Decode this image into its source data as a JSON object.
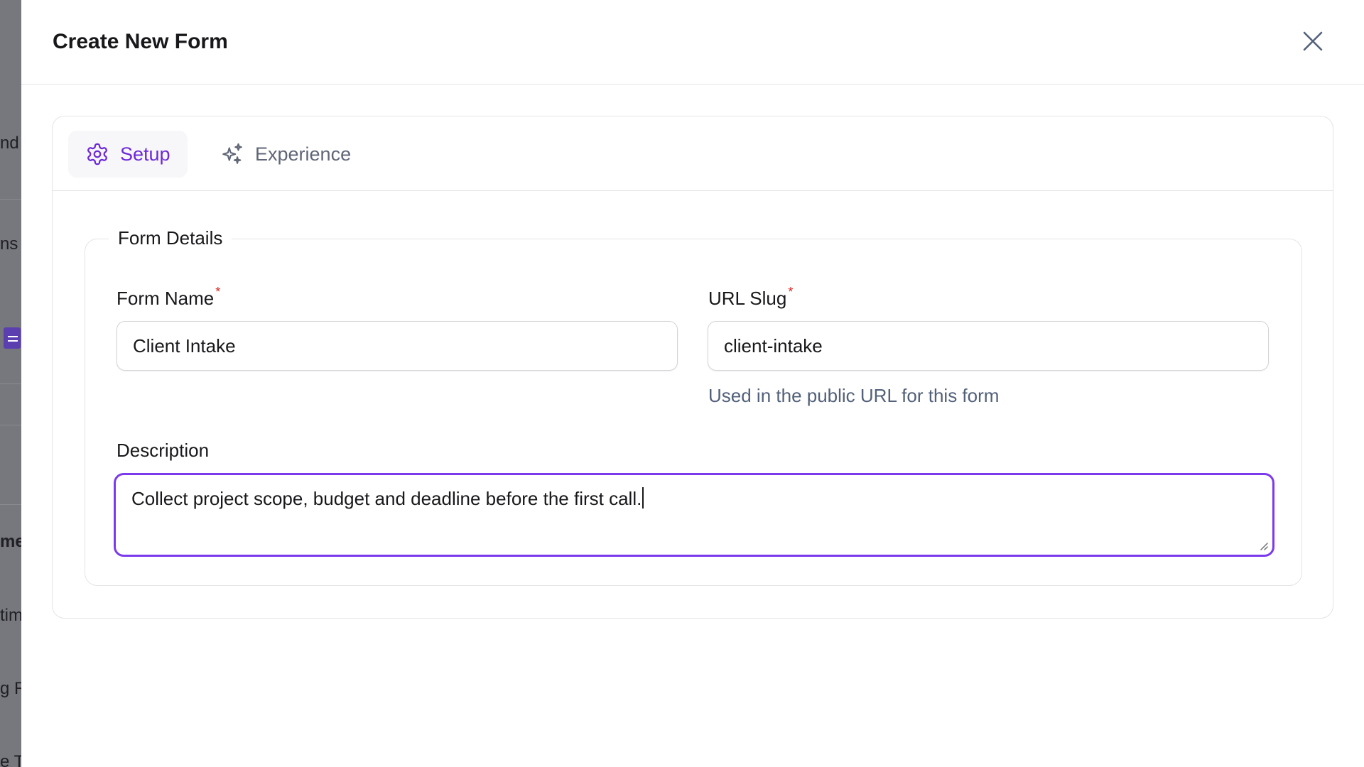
{
  "background_fragments": [
    "nd",
    "ns",
    "me",
    "tim",
    "g Ro",
    "e T"
  ],
  "modal": {
    "title": "Create New Form",
    "close_icon": "close-icon"
  },
  "tabs": [
    {
      "label": "Setup",
      "icon": "gear-icon",
      "active": true
    },
    {
      "label": "Experience",
      "icon": "sparkles-icon",
      "active": false
    }
  ],
  "form_details": {
    "legend": "Form Details",
    "form_name": {
      "label": "Form Name",
      "required_marker": "*",
      "value": "Client Intake"
    },
    "url_slug": {
      "label": "URL Slug",
      "required_marker": "*",
      "value": "client-intake",
      "hint": "Used in the public URL for this form"
    },
    "description": {
      "label": "Description",
      "value": "Collect project scope, budget and deadline before the first call."
    }
  },
  "colors": {
    "accent": "#6d28d9",
    "focus_border": "#7c3aed",
    "required": "#dc2626",
    "muted_text": "#52607a"
  }
}
